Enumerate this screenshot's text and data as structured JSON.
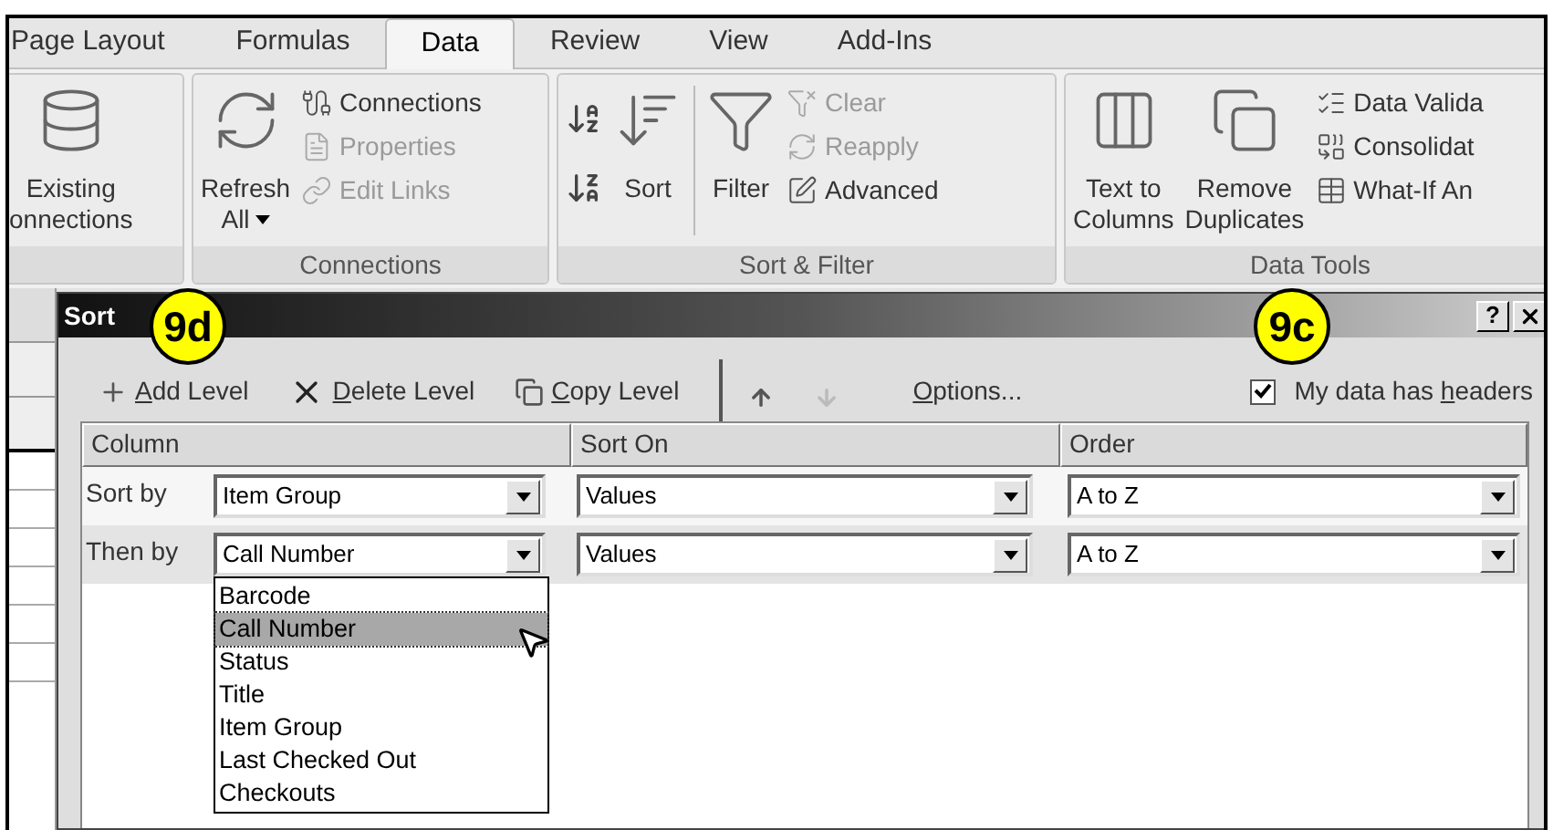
{
  "ribbon": {
    "tabs": [
      {
        "label": "Page Layout",
        "selected": false
      },
      {
        "label": "Formulas",
        "selected": false
      },
      {
        "label": "Data",
        "selected": true
      },
      {
        "label": "Review",
        "selected": false
      },
      {
        "label": "View",
        "selected": false
      },
      {
        "label": "Add-Ins",
        "selected": false
      }
    ],
    "groups": [
      {
        "columns": [
          {
            "kind": "large",
            "lines": [
              "Existing",
              "onnections"
            ],
            "dropdown": false
          }
        ]
      },
      {
        "title": "Connections",
        "columns": [
          {
            "kind": "large",
            "lines": [
              "Refresh",
              "All"
            ],
            "dropdown": true
          },
          {
            "kind": "small",
            "items": [
              {
                "label": "Connections",
                "disabled": false
              },
              {
                "label": "Properties",
                "disabled": true
              },
              {
                "label": "Edit Links",
                "disabled": true
              }
            ]
          }
        ]
      },
      {
        "title": "Sort & Filter",
        "columns": [
          {
            "kind": "sort_pair"
          },
          {
            "kind": "large",
            "lines": [
              "Sort"
            ],
            "dropdown": false
          },
          {
            "kind": "divider"
          },
          {
            "kind": "large",
            "lines": [
              "Filter"
            ],
            "dropdown": false
          },
          {
            "kind": "small",
            "items": [
              {
                "label": "Clear",
                "disabled": true
              },
              {
                "label": "Reapply",
                "disabled": true
              },
              {
                "label": "Advanced",
                "disabled": false
              }
            ]
          }
        ]
      },
      {
        "title": "Data Tools",
        "columns": [
          {
            "kind": "large",
            "lines": [
              "Text to",
              "Columns"
            ],
            "dropdown": false
          },
          {
            "kind": "large",
            "lines": [
              "Remove",
              "Duplicates"
            ],
            "dropdown": false
          },
          {
            "kind": "small",
            "items": [
              {
                "label": "Data Valida",
                "disabled": false
              },
              {
                "label": "Consolidat",
                "disabled": false
              },
              {
                "label": "What-If An",
                "disabled": false
              }
            ]
          }
        ]
      }
    ]
  },
  "dialog": {
    "title": "Sort",
    "help": "?",
    "toolbar": [
      {
        "kind": "add",
        "label": "Add Level",
        "disabled": false
      },
      {
        "kind": "delete",
        "label": "Delete Level",
        "disabled": false
      },
      {
        "kind": "copy",
        "label": "Copy Level",
        "disabled": false
      },
      {
        "kind": "separator"
      },
      {
        "kind": "up",
        "disabled": false
      },
      {
        "kind": "down",
        "disabled": true
      },
      {
        "kind": "options",
        "label": "Options...",
        "disabled": false
      }
    ],
    "headers_checkbox": {
      "label": "My data has headers",
      "checked": true
    },
    "columns": [
      "Column",
      "Sort On",
      "Order"
    ],
    "rows": [
      {
        "label": "Sort by",
        "column": "Item Group",
        "sort_on": "Values",
        "order": "A to Z",
        "selected": false,
        "open": false
      },
      {
        "label": "Then by",
        "column": "Call Number",
        "sort_on": "Values",
        "order": "A to Z",
        "selected": true,
        "open": true
      }
    ],
    "dropdown_options": [
      {
        "label": "Barcode",
        "selected": false
      },
      {
        "label": "Call Number",
        "selected": true
      },
      {
        "label": "Status",
        "selected": false
      },
      {
        "label": "Title",
        "selected": false
      },
      {
        "label": "Item Group",
        "selected": false
      },
      {
        "label": "Last Checked Out",
        "selected": false
      },
      {
        "label": "Checkouts",
        "selected": false
      }
    ]
  },
  "callouts": [
    {
      "label": "9d"
    },
    {
      "label": "9c"
    }
  ]
}
